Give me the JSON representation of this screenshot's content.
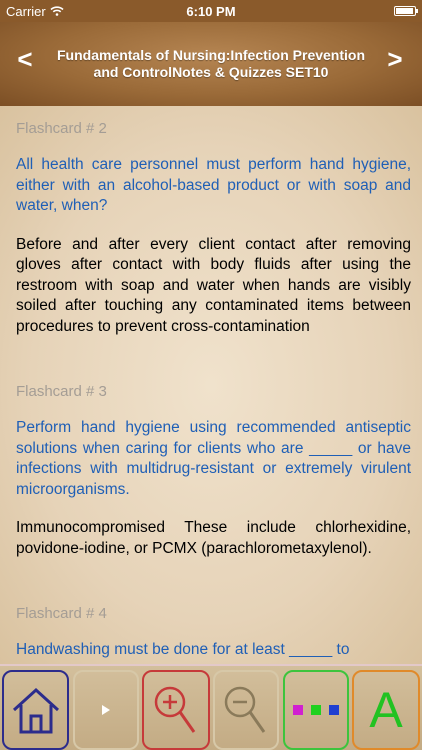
{
  "status": {
    "carrier": "Carrier",
    "time": "6:10 PM",
    "battery_level": 0.92
  },
  "nav": {
    "title": "Fundamentals of Nursing:Infection Prevention and ControlNotes & Quizzes SET10",
    "prev_label": "<",
    "next_label": ">"
  },
  "cards": [
    {
      "header": "Flashcard # 2",
      "question": "All health care personnel must perform hand hygiene, either with an alcohol-based product or with soap and water, when?",
      "answer": "Before and after every client contact after removing gloves after contact with body fluids after using the restroom with soap and water when hands are visibly soiled after touching any contaminated items between procedures to prevent cross-contamination"
    },
    {
      "header": "Flashcard # 3",
      "question": "Perform hand hygiene using recommended antiseptic solutions when caring for clients who are _____ or have infections with multidrug-resistant or extremely virulent microorganisms.",
      "answer": "Immunocompromised These include chlorhexidine, povidone-iodine, or PCMX (parachlorometaxylenol)."
    },
    {
      "header": "Flashcard # 4",
      "question": "Handwashing must be done for at least _____ to",
      "answer": ""
    }
  ],
  "toolbar": {
    "items": [
      {
        "name": "home",
        "icon": "home-icon",
        "color": "#2c2c8c"
      },
      {
        "name": "play",
        "icon": "play-icon",
        "color": "#ffffff"
      },
      {
        "name": "zoom-in",
        "icon": "zoom-in-icon",
        "color": "#c63a3a"
      },
      {
        "name": "zoom-out",
        "icon": "zoom-out-icon",
        "color": "#8a7a5a"
      },
      {
        "name": "colors",
        "icon": "color-dots-icon",
        "colors": [
          "#d11fd1",
          "#1fd11f",
          "#1f3fd1"
        ]
      },
      {
        "name": "font",
        "icon": "font-icon",
        "label": "A",
        "color": "#22c222"
      }
    ]
  },
  "colors": {
    "question_text": "#1f5fb6",
    "answer_text": "#000000",
    "header_text": "#a49d95"
  }
}
